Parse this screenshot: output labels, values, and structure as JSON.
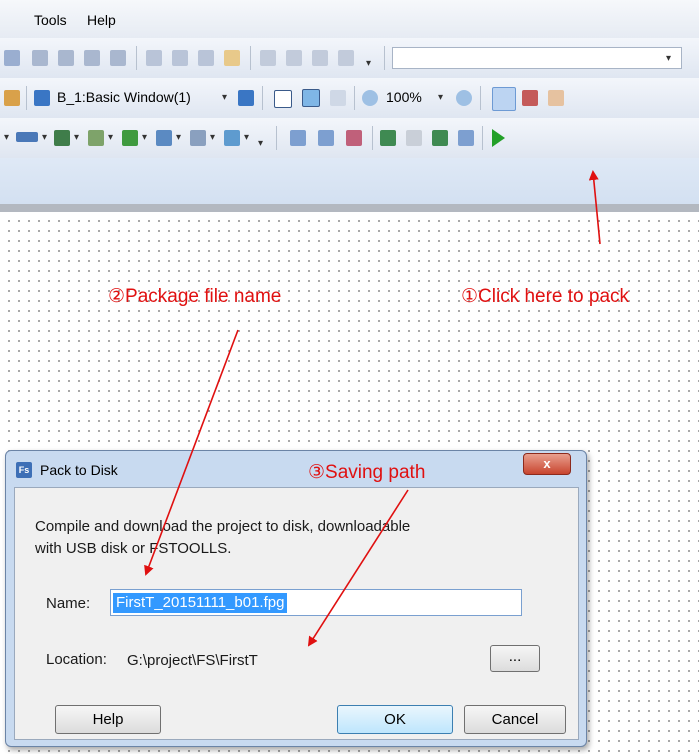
{
  "menu": {
    "tools": "Tools",
    "help": "Help"
  },
  "toolbar": {
    "window_select": "B_1:Basic Window(1)",
    "zoom": "100%"
  },
  "annotations": {
    "pack": "①Click here to pack",
    "package_name": "②Package file name",
    "saving_path": "③Saving path"
  },
  "dialog": {
    "title": "Pack to Disk",
    "logo": "Fs",
    "close": "x",
    "description_line1": "Compile and download the project to disk, downloadable",
    "description_line2": "with USB disk or FSTOOLLS.",
    "name_label": "Name:",
    "name_value": "FirstT_20151111_b01.fpg",
    "location_label": "Location:",
    "location_value": "G:\\project\\FS\\FirstT",
    "browse_label": "...",
    "help_label": "Help",
    "ok_label": "OK",
    "cancel_label": "Cancel"
  },
  "colors": {
    "annotation": "#e01010",
    "selection": "#3399ff"
  }
}
